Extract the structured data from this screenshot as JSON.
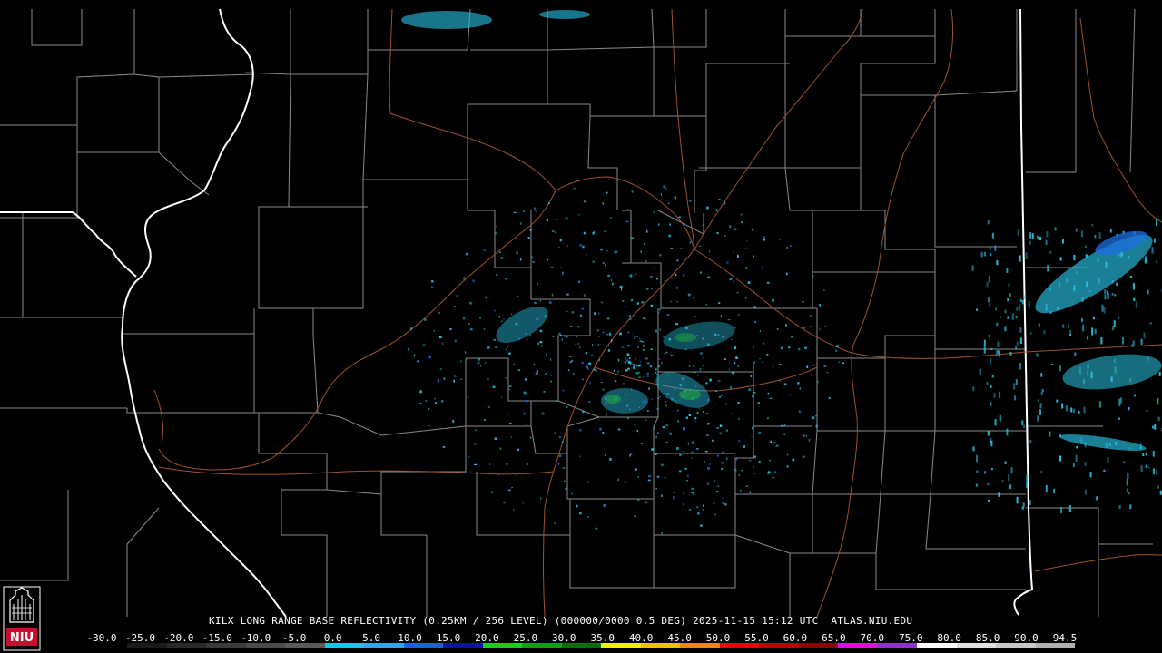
{
  "product_line": "KILX LONG RANGE BASE REFLECTIVITY (0.25KM / 256 LEVEL) (000000/0000 0.5 DEG) 2025-11-15 15:12 UTC  ATLAS.NIU.EDU",
  "logo_text": "NIU",
  "colors": {
    "background": "#000000",
    "county_lines": "#8a8a8a",
    "state_lines": "#ffffff",
    "highways": "#a0522d",
    "echo_light": "#29c4e6",
    "echo_mid": "#1e6fe0",
    "echo_heavy": "#1fae3f",
    "logo_red": "#c8102e"
  },
  "scale": {
    "labels": [
      "-30.0",
      "-25.0",
      "-20.0",
      "-15.0",
      "-10.0",
      "-5.0",
      "0.0",
      "5.0",
      "10.0",
      "15.0",
      "20.0",
      "25.0",
      "30.0",
      "35.0",
      "40.0",
      "45.0",
      "50.0",
      "55.0",
      "60.0",
      "65.0",
      "70.0",
      "75.0",
      "80.0",
      "85.0",
      "90.0",
      "94.5"
    ],
    "colors": [
      "#000000",
      "#1a1a1a",
      "#2a2a2a",
      "#3a3a3a",
      "#4a4a4a",
      "#5a5a5a",
      "#0dcbe6",
      "#2ea6f0",
      "#1a60e8",
      "#0a10b8",
      "#18d018",
      "#12a012",
      "#0a700a",
      "#f0f000",
      "#f0c000",
      "#f08800",
      "#f00000",
      "#c00000",
      "#900000",
      "#f000f0",
      "#9030d0",
      "#ffffff",
      "#e0e0e0",
      "#c8c8c8",
      "#b0b0b0"
    ]
  }
}
